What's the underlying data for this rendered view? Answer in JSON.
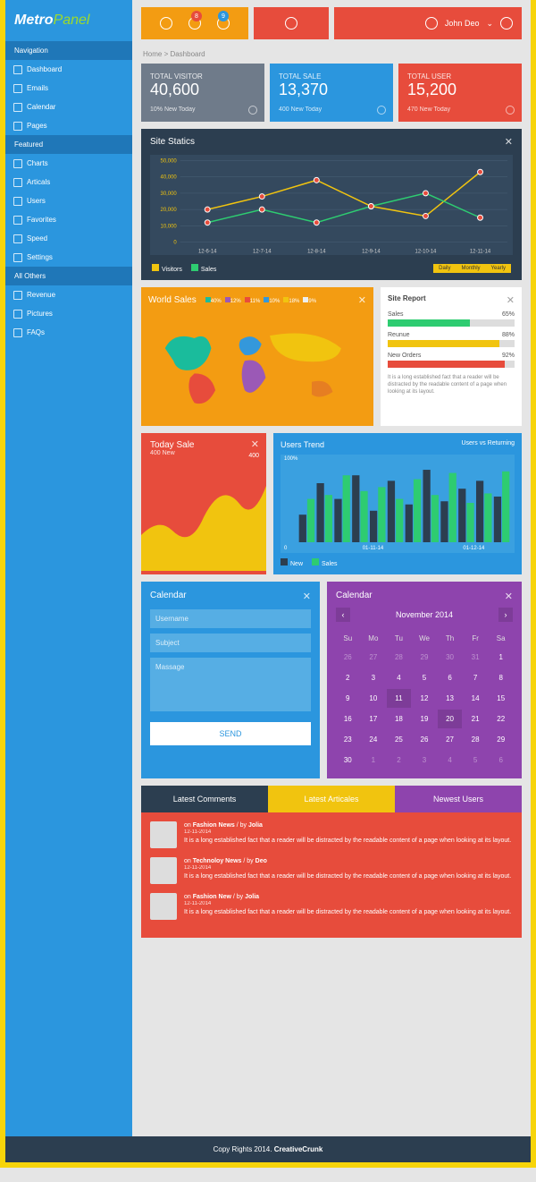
{
  "logo": {
    "a": "Metro",
    "b": "Panel"
  },
  "topbar": {
    "badge1": "8",
    "badge2": "9",
    "user": "John Deo"
  },
  "breadcrumb": "Home > Dashboard",
  "sidebar": {
    "heads": [
      "Navigation",
      "Featured",
      "All Others"
    ],
    "nav": [
      "Dashboard",
      "Emails",
      "Calendar",
      "Pages"
    ],
    "featured": [
      "Charts",
      "Articals",
      "Users",
      "Favorites",
      "Speed",
      "Settings"
    ],
    "others": [
      "Revenue",
      "Pictures",
      "FAQs"
    ]
  },
  "stats": [
    {
      "t": "TOTAL VISITOR",
      "v": "40,600",
      "s": "10% New Today"
    },
    {
      "t": "TOTAL SALE",
      "v": "13,370",
      "s": "400 New Today"
    },
    {
      "t": "TOTAL USER",
      "v": "15,200",
      "s": "470 New Today"
    }
  ],
  "chart": {
    "title": "Site Statics",
    "legend": [
      "Visitors",
      "Sales"
    ],
    "buttons": [
      "Daily",
      "Monthly",
      "Yearly"
    ]
  },
  "chart_data": [
    {
      "type": "line",
      "title": "Site Statics",
      "categories": [
        "12-6-14",
        "12-7-14",
        "12-8-14",
        "12-9-14",
        "12-10-14",
        "12-11-14"
      ],
      "ylim": [
        0,
        50000
      ],
      "yticks": [
        0,
        10000,
        20000,
        30000,
        40000,
        50000
      ],
      "series": [
        {
          "name": "Visitors",
          "color": "#f1c40f",
          "values": [
            20000,
            28000,
            38000,
            22000,
            16000,
            43000
          ]
        },
        {
          "name": "Sales",
          "color": "#2ecc71",
          "values": [
            12000,
            20000,
            12000,
            22000,
            30000,
            15000
          ]
        }
      ]
    },
    {
      "type": "bar",
      "title": "Users Trend",
      "subtitle": "Users vs Returning",
      "categories": [
        "01-11-14",
        "01-12-14"
      ],
      "ylim": [
        0,
        100
      ],
      "series": [
        {
          "name": "New",
          "color": "#2c3e50",
          "values": [
            35,
            75,
            55,
            85,
            40,
            78,
            48,
            92,
            52,
            68,
            78,
            58
          ]
        },
        {
          "name": "Sales",
          "color": "#2ecc71",
          "values": [
            55,
            60,
            85,
            65,
            70,
            55,
            80,
            60,
            88,
            50,
            62,
            90
          ]
        }
      ]
    }
  ],
  "world": {
    "title": "World Sales",
    "pcts": [
      {
        "c": "#1abc9c",
        "v": "40%"
      },
      {
        "c": "#9b59b6",
        "v": "12%"
      },
      {
        "c": "#e74c3c",
        "v": "11%"
      },
      {
        "c": "#3498db",
        "v": "10%"
      },
      {
        "c": "#f1c40f",
        "v": "18%"
      },
      {
        "c": "#ecf0f1",
        "v": "9%"
      }
    ]
  },
  "report": {
    "title": "Site Report",
    "rows": [
      {
        "l": "Sales",
        "v": 65,
        "c": "#2ecc71"
      },
      {
        "l": "Reunue",
        "v": 88,
        "c": "#f1c40f"
      },
      {
        "l": "New Orders",
        "v": 92,
        "c": "#e74c3c"
      }
    ],
    "txt": "It is a long established fact that a reader will be distracted by the readable content of a page when looking at its layout."
  },
  "today": {
    "title": "Today Sale",
    "sub": "400 New",
    "val": "400"
  },
  "trend": {
    "title": "Users Trend",
    "sub": "Users vs Returning",
    "legend": [
      "New",
      "Sales"
    ],
    "ymax": "100%",
    "xlabels": [
      "01-11-14",
      "01-12-14"
    ]
  },
  "form": {
    "title": "Calendar",
    "ph_user": "Username",
    "ph_subj": "Subject",
    "ph_msg": "Massage",
    "send": "SEND"
  },
  "calendar": {
    "title": "Calendar",
    "month": "November 2014",
    "days": [
      "Su",
      "Mo",
      "Tu",
      "We",
      "Th",
      "Fr",
      "Sa"
    ],
    "cells": [
      {
        "n": "26",
        "dim": 1
      },
      {
        "n": "27",
        "dim": 1
      },
      {
        "n": "28",
        "dim": 1
      },
      {
        "n": "29",
        "dim": 1
      },
      {
        "n": "30",
        "dim": 1
      },
      {
        "n": "31",
        "dim": 1
      },
      {
        "n": "1"
      },
      {
        "n": "2"
      },
      {
        "n": "3"
      },
      {
        "n": "4"
      },
      {
        "n": "5"
      },
      {
        "n": "6"
      },
      {
        "n": "7"
      },
      {
        "n": "8"
      },
      {
        "n": "9"
      },
      {
        "n": "10"
      },
      {
        "n": "11",
        "sel": 1
      },
      {
        "n": "12"
      },
      {
        "n": "13"
      },
      {
        "n": "14"
      },
      {
        "n": "15"
      },
      {
        "n": "16"
      },
      {
        "n": "17"
      },
      {
        "n": "18"
      },
      {
        "n": "19"
      },
      {
        "n": "20",
        "sel": 1
      },
      {
        "n": "21"
      },
      {
        "n": "22"
      },
      {
        "n": "23"
      },
      {
        "n": "24"
      },
      {
        "n": "25"
      },
      {
        "n": "26"
      },
      {
        "n": "27"
      },
      {
        "n": "28"
      },
      {
        "n": "29"
      },
      {
        "n": "30"
      },
      {
        "n": "1",
        "dim": 1
      },
      {
        "n": "2",
        "dim": 1
      },
      {
        "n": "3",
        "dim": 1
      },
      {
        "n": "4",
        "dim": 1
      },
      {
        "n": "5",
        "dim": 1
      },
      {
        "n": "6",
        "dim": 1
      }
    ]
  },
  "tabs": [
    "Latest Comments",
    "Latest Articales",
    "Newest Users"
  ],
  "comments": [
    {
      "cat": "Fashion News",
      "by": "Jolia",
      "date": "12-11-2014",
      "txt": "It is a long established fact that a reader will be distracted by the readable content of a page when looking at its layout."
    },
    {
      "cat": "Technoloy News",
      "by": "Deo",
      "date": "12-11-2014",
      "txt": "It is a long established fact that a reader will be distracted by the readable content of a page when looking at its layout."
    },
    {
      "cat": "Fashion New",
      "by": "Jolia",
      "date": "12-11-2014",
      "txt": "It is a long established fact that a reader will be distracted by the readable content of a page when looking at its layout."
    }
  ],
  "footer": {
    "a": "Copy Rights 2014.",
    "b": "CreativeCrunk"
  }
}
